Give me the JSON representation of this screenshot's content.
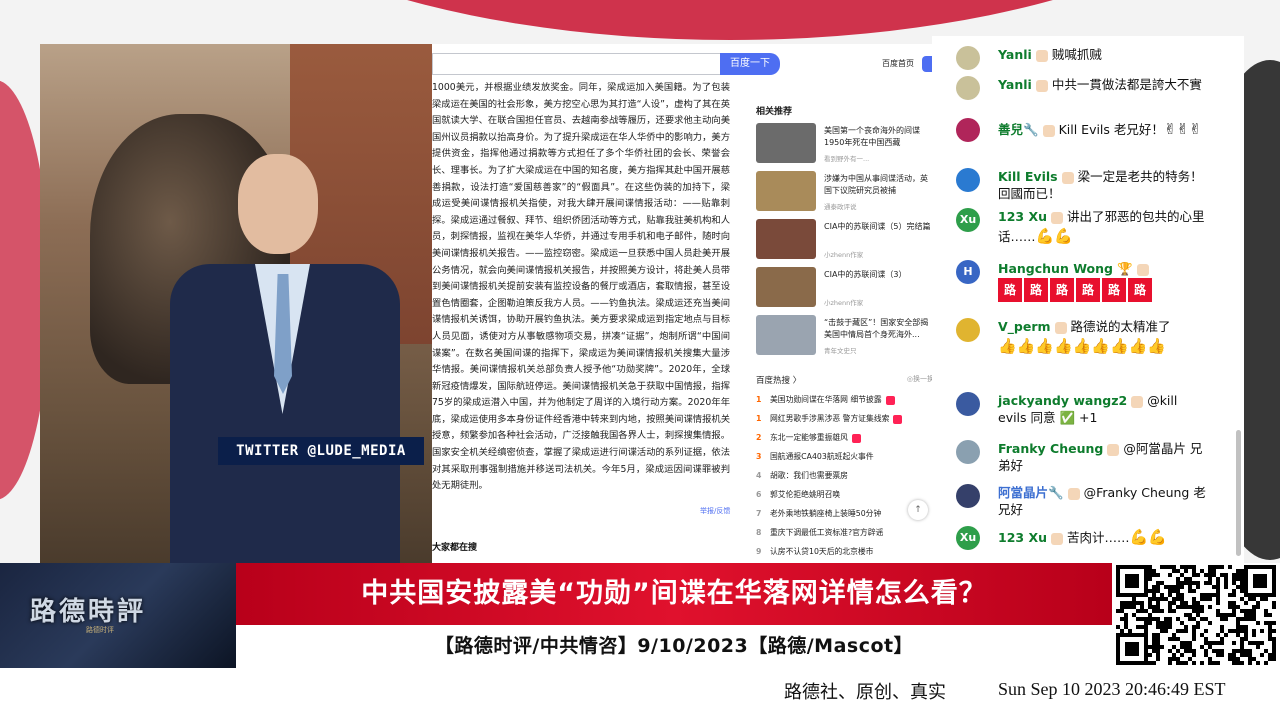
{
  "twitter_tag": "TWITTER @LUDE_MEDIA",
  "browser": {
    "search_button": "百度一下",
    "home_link": "百度首页",
    "article_text": "1000美元，并根据业绩发放奖金。同年，梁成运加入美国籍。为了包装梁成运在美国的社会形象，美方挖空心思为其打造“人设”，虚构了其在英国就读大学、在联合国担任官员、去越南参战等履历，还要求他主动向美国州议员捐款以抬高身价。为了提升梁成运在华人华侨中的影响力，美方提供资金，指挥他通过捐款等方式担任了多个华侨社团的会长、荣誉会长、理事长。为了扩大梁成运在中国的知名度，美方指挥其赴中国开展慈善捐款，设法打造“爱国慈善家”的“假面具”。在这些伪装的加持下，梁成运受美间谍情报机关指使，对我大肆开展间谍情报活动：——贴靠刺探。梁成运通过餐叙、拜节、组织侨团活动等方式，贴靠我驻美机构和人员，刺探情报，监视在美华人华侨，并通过专用手机和电子邮件，随时向美间谍情报机关报告。——监控窃密。梁成运一旦获悉中国人员赴美开展公务情况，就会向美间谍情报机关报告，并按照美方设计，将赴美人员带到美间谍情报机关提前安装有监控设备的餐厅或酒店，套取情报，甚至设置色情圈套，企图勒迫策反我方人员。——钓鱼执法。梁成运还充当美间谍情报机关诱饵，协助开展钓鱼执法。美方要求梁成运到指定地点与目标人员见面，诱使对方从事敏感物项交易，拼凑“证据”，炮制所谓“中国间谍案”。在数名美国间谍的指挥下，梁成运为美间谍情报机关搜集大量涉华情报。美间谍情报机关总部负责人授予他“功勋奖牌”。2020年，全球新冠疫情爆发，国际航班停运。美间谍情报机关急于获取中国情报，指挥75岁的梁成运潜入中国，并为他制定了周详的入境行动方案。2020年年底，梁成运使用多本身份证件经香港中转来到内地，按照美间谍情报机关授意，频繁参加各种社会活动，广泛接触我国各界人士，刺探搜集情报。国家安全机关经缜密侦查，掌握了梁成运进行间谍活动的系列证据，依法对其采取刑事强制措施并移送司法机关。今年5月，梁成运因间谍罪被判处无期徒刑。",
    "report_link": "举报/反馈",
    "all_search": "大家都在搜",
    "related_heading": "相关推荐",
    "related": [
      {
        "title": "美国第一个丧命海外的间谍 1950年死在中国西藏",
        "source": "看到野外有一...",
        "color": "#6b6b6b"
      },
      {
        "title": "涉嫌为中国从事间谍活动，英国下议院研究员被捕",
        "source": "通泰政评说",
        "color": "#a98b5a"
      },
      {
        "title": "CIA中的苏联间谍（5）完结篇",
        "source": "小zhenn作家",
        "color": "#7a4a3a"
      },
      {
        "title": "CIA中的苏联间谍（3）",
        "source": "小zhenn作家",
        "color": "#8a6a4a"
      },
      {
        "title": "“击鼓于藏区”！国家安全部揭美国中情局首个身死海外...",
        "source": "青年文史只",
        "color": "#9aa4b0"
      }
    ],
    "hot_heading": "百度热搜 〉",
    "hot_refresh": "◎换一换",
    "hot": [
      {
        "num": "1",
        "text": "美国功勋间谍在华落网 细节披露"
      },
      {
        "num": "1",
        "text": "网红男歌手涉黑涉恶 警方证集线索"
      },
      {
        "num": "2",
        "text": "东北一定能够重振雄风"
      },
      {
        "num": "3",
        "text": "国航通报CA403航班起火事件"
      },
      {
        "num": "4",
        "text": "胡歌：我们也需要票房"
      },
      {
        "num": "6",
        "text": "郭艾伦拒绝姚明召唤"
      },
      {
        "num": "7",
        "text": "老外乘地铁躺座椅上装睡50分钟"
      },
      {
        "num": "8",
        "text": "重庆下调最低工资标准?官方辟谣"
      },
      {
        "num": "9",
        "text": "认房不认贷10天后的北京楼市"
      }
    ]
  },
  "chat": [
    {
      "author": "Yanli",
      "text": "贼喊抓贼",
      "avatar_color": "#c9c19a"
    },
    {
      "author": "Yanli",
      "text": "中共一貫做法都是誇大不實",
      "avatar_color": "#c9c19a"
    },
    {
      "author": "善兒🔧",
      "text": "Kill Evils 老兄好！",
      "emojis": "✌✌✌",
      "avatar_color": "#b0255a"
    },
    {
      "author": "Kill Evils",
      "text": "梁一定是老共的特务！回國而已！",
      "avatar_color": "#2a7ad1"
    },
    {
      "author": "123 Xu",
      "text": "讲出了邪恶的包共的心里话……",
      "emojis": "💪💪",
      "avatar_color": "#2e9e4a",
      "avatar_letter": "Xu"
    },
    {
      "author": "Hangchun Wong 🏆",
      "road_count": 6,
      "avatar_color": "#3866c4",
      "avatar_letter": "H",
      "road_char": "路"
    },
    {
      "author": "V_perm",
      "text": "路德说的太精准了",
      "emojis": "👍👍👍👍👍👍👍👍👍",
      "avatar_color": "#e0b430"
    },
    {
      "author": "jackyandy wangz2",
      "text": "@kill evils 同意 ✅ +1",
      "avatar_color": "#3a5aa0"
    },
    {
      "author": "Franky Cheung",
      "text": "@阿當晶片 兄弟好",
      "avatar_color": "#8aa0b0"
    },
    {
      "author": "阿當晶片🔧",
      "text": "@Franky Cheung 老兄好",
      "avatar_color": "#35406a",
      "blue": true
    },
    {
      "author": "123 Xu",
      "text": "苦肉计……",
      "emojis": "💪💪",
      "avatar_color": "#2e9e4a",
      "avatar_letter": "Xu"
    }
  ],
  "banner": {
    "logo": "路德時評",
    "logo_sub": "路德时评",
    "title": "中共国安披露美“功勋”间谍在华落网详情怎么看？",
    "subtitle": "【路德时评/中共情咨】9/10/2023【路德/Mascot】"
  },
  "footer": {
    "brand": "路德社、原创、真实",
    "time": "Sun Sep 10 2023 20:46:49 EST"
  },
  "colors": {
    "accent_red": "#e0112d",
    "baidu_blue": "#4e6ef2",
    "chat_green": "#0e7c2d"
  }
}
